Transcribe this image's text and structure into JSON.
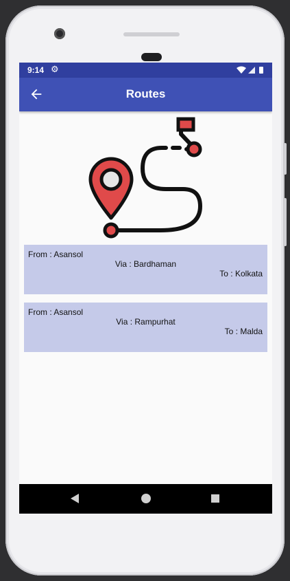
{
  "status_bar": {
    "time": "9:14",
    "icons": [
      "gear-icon",
      "wifi-icon",
      "signal-icon",
      "battery-icon"
    ]
  },
  "app_bar": {
    "title": "Routes",
    "back_icon": "arrow-back-icon"
  },
  "colors": {
    "status_bar": "#303f9f",
    "app_bar": "#3f51b5",
    "card": "#c5cae9",
    "pin_red": "#e04a4a"
  },
  "routes": [
    {
      "from": "From : Asansol",
      "via": "Via : Bardhaman",
      "to": "To : Kolkata"
    },
    {
      "from": "From : Asansol",
      "via": "Via : Rampurhat",
      "to": "To : Malda"
    }
  ],
  "nav_bar": {
    "icons": [
      "nav-back-icon",
      "nav-home-icon",
      "nav-recents-icon"
    ]
  }
}
